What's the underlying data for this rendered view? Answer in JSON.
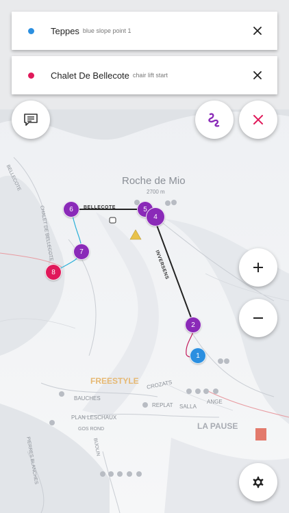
{
  "selections": [
    {
      "title": "Teppes",
      "subtitle": "blue slope point 1",
      "color": "#2b8fe0"
    },
    {
      "title": "Chalet De Bellecote",
      "subtitle": "chair lift start",
      "color": "#e0195a"
    }
  ],
  "icons": {
    "close": "close-icon",
    "comment": "comment-icon",
    "route": "route-icon",
    "cancel": "cancel-icon",
    "zoom_in": "plus-icon",
    "zoom_out": "minus-icon",
    "settings": "gear-icon"
  },
  "colors": {
    "accent_purple": "#8a2ab8",
    "accent_pink": "#e0195a",
    "accent_blue": "#2b8fe0"
  },
  "map": {
    "peak_name": "Roche de Mio",
    "peak_altitude": "2700 m",
    "lift_bellecote": "BELLECOTE",
    "lift_inversens": "INVERSENS",
    "label_freestyle": "FREESTYLE",
    "label_plagne": "LA PAUSE",
    "label_crozats": "CROZATS",
    "label_bauches": "BAUCHES",
    "label_plan_leschaux": "PLAN LESCHAUX",
    "label_replat": "REPLAT",
    "label_salla": "SALLA",
    "label_ange": "ANGE",
    "label_gos_rond": "GOS ROND",
    "label_bijolin": "BIJOLIN",
    "label_pierres_blanches": "PIERRES BLANCHES",
    "label_bellecote_side": "BELLECOTE",
    "label_chalet_side": "CHALET DE BELLECOTE"
  },
  "markers": [
    {
      "label": "1",
      "color": "#2b8fe0"
    },
    {
      "label": "2",
      "color": "#8a2ab8"
    },
    {
      "label": "4",
      "color": "#8a2ab8"
    },
    {
      "label": "5",
      "color": "#8a2ab8"
    },
    {
      "label": "6",
      "color": "#8a2ab8"
    },
    {
      "label": "7",
      "color": "#8a2ab8"
    },
    {
      "label": "8",
      "color": "#e0195a"
    }
  ]
}
